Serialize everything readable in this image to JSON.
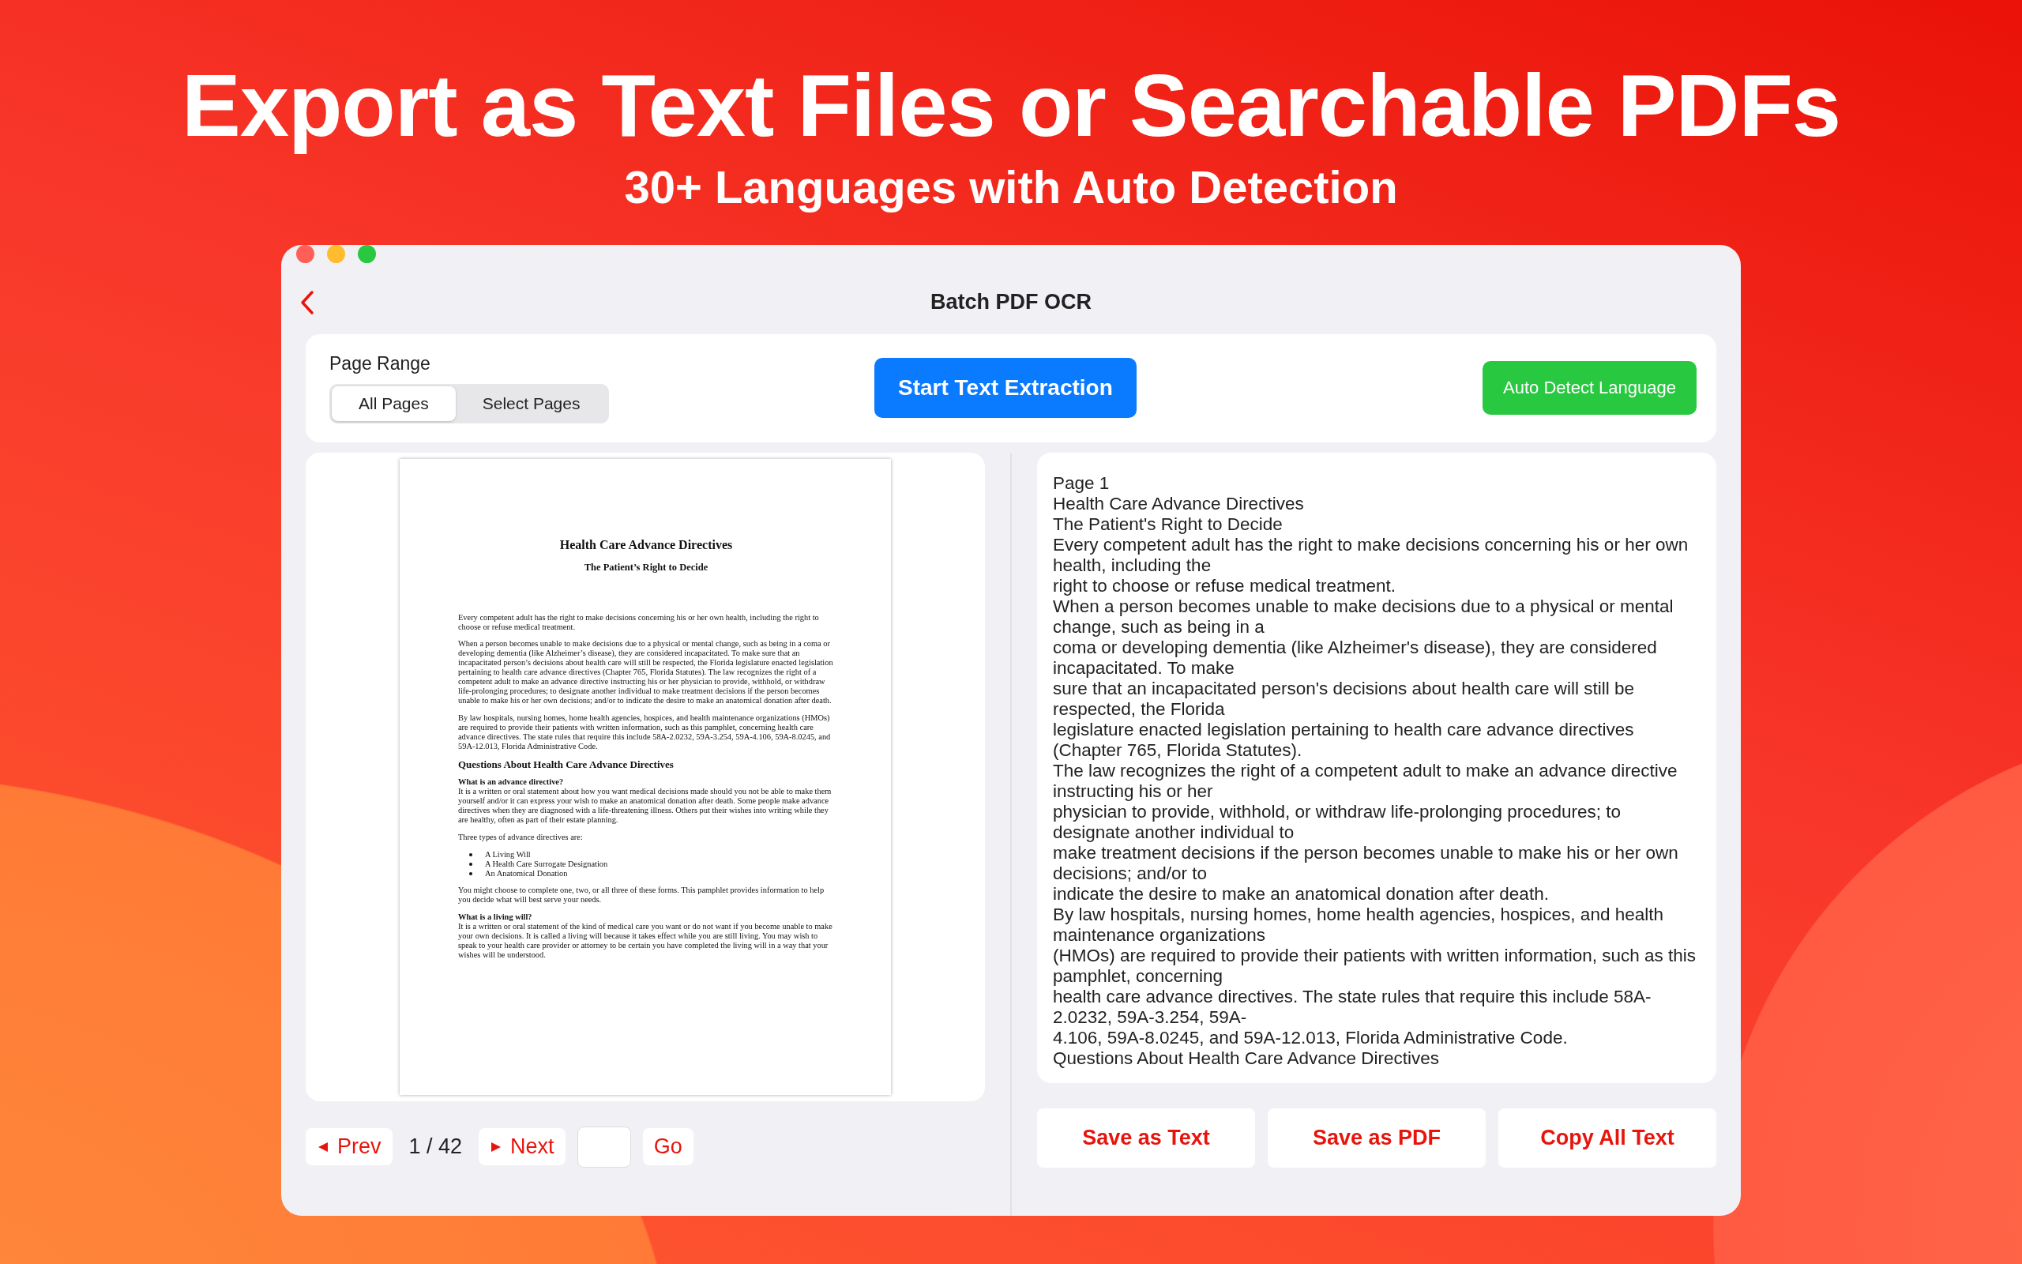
{
  "headline": "Export as Text Files or Searchable PDFs",
  "subheadline": "30+ Languages with Auto Detection",
  "window": {
    "title": "Batch PDF OCR"
  },
  "page_range": {
    "label": "Page Range",
    "options": [
      {
        "label": "All Pages",
        "selected": true
      },
      {
        "label": "Select Pages",
        "selected": false
      }
    ]
  },
  "start_button": "Start Text Extraction",
  "language_button": "Auto Detect Language",
  "document": {
    "title": "Health Care Advance Directives",
    "subtitle": "The Patient’s Right to Decide",
    "blocks": [
      {
        "kind": "para",
        "text": "Every competent adult has the right to make decisions concerning his or her own health, including the right to choose or refuse medical treatment."
      },
      {
        "kind": "para",
        "text": "When a person becomes unable to make decisions due to a physical or mental change, such as being in a coma or developing dementia (like Alzheimer’s disease), they are considered incapacitated.  To make sure that an incapacitated person’s decisions about health care will still be respected, the Florida legislature enacted legislation pertaining to health care advance directives (Chapter 765, Florida Statutes). The law recognizes the right of a competent adult to make an advance directive instructing his or her physician to provide, withhold, or withdraw life-prolonging procedures; to designate another individual to make treatment decisions if the person becomes unable to make his or her own decisions; and/or to indicate the desire to make an anatomical donation after death."
      },
      {
        "kind": "para",
        "text": "By law hospitals, nursing homes, home health agencies, hospices, and health maintenance organizations (HMOs) are required to provide their patients with written information, such as this pamphlet, concerning health care advance directives.  The state rules that require this include 58A-2.0232, 59A-3.254, 59A-4.106, 59A-8.0245, and 59A-12.013, Florida Administrative Code."
      },
      {
        "kind": "heading",
        "text": "Questions About Health Care Advance Directives"
      },
      {
        "kind": "question",
        "title": "What is an advance directive?",
        "text": "It is a written or oral statement about how you want medical decisions made should you not be able to make them yourself and/or it can express your wish to make an anatomical donation after death.  Some people make advance directives when they are diagnosed with a life-threatening illness.  Others put their wishes into writing while they are healthy, often as part of their estate planning."
      },
      {
        "kind": "para",
        "text": "Three types of advance directives are:"
      },
      {
        "kind": "list",
        "items": [
          "A Living Will",
          "A Health Care Surrogate Designation",
          "An Anatomical Donation"
        ]
      },
      {
        "kind": "para",
        "text": "You might choose to complete one, two, or all three of these forms.  This pamphlet provides information to help you decide what will best serve your needs."
      },
      {
        "kind": "question",
        "title": "What is a living will?",
        "text": "It is a written or oral statement of the kind of medical care you want or do not want if you become unable to make your own decisions.  It is called a living will because it takes effect while you are still living. You may wish to speak to your health care provider or attorney to be certain you have completed the living will in a way that your wishes will be understood."
      }
    ]
  },
  "pager": {
    "prev": "Prev",
    "position": "1 / 42",
    "next": "Next",
    "go": "Go"
  },
  "extracted_text": [
    "Page 1",
    "Health Care Advance Directives",
    "The Patient's Right to Decide",
    "Every competent adult has the right to make decisions concerning his or her own health, including the",
    "right to choose or refuse medical treatment.",
    "When a person becomes unable to make decisions due to a physical or mental change, such as being in a",
    "coma or developing dementia (like Alzheimer's disease), they are considered incapacitated. To make",
    "sure that an incapacitated person's decisions about health care will still be respected, the Florida",
    "legislature enacted legislation pertaining to health care advance directives (Chapter 765, Florida Statutes).",
    "The law recognizes the right of a competent adult to make an advance directive instructing his or her",
    "physician to provide, withhold, or withdraw life-prolonging procedures; to designate another individual to",
    "make treatment decisions if the person becomes unable to make his or her own decisions; and/or to",
    "indicate the desire to make an anatomical donation after death.",
    "By law hospitals, nursing homes, home health agencies, hospices, and health maintenance organizations",
    "(HMOs) are required to provide their patients with written information, such as this pamphlet, concerning",
    "health care advance directives. The state rules that require this include 58A-2.0232, 59A-3.254, 59A-",
    "4.106, 59A-8.0245, and 59A-12.013, Florida Administrative Code.",
    "Questions About Health Care Advance Directives"
  ],
  "actions": [
    "Save as Text",
    "Save as PDF",
    "Copy All Text"
  ]
}
